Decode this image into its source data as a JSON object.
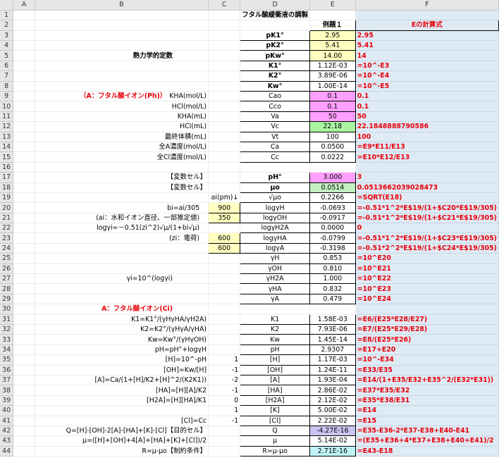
{
  "columns": [
    "A",
    "B",
    "C",
    "D",
    "E",
    "F"
  ],
  "title": "フタル酸緩衝液の調製",
  "row2": {
    "E": "例題１",
    "F": "Eの計算式"
  },
  "thermo_label": "熱力学的定数",
  "section_A_Ph": "（A：フタル酸イオン(Ph)）",
  "section_A_Ci": "A：フタル酸イオン(Ci)",
  "rows": [
    {
      "n": "1",
      "B": "",
      "C": "",
      "D": "",
      "E": "",
      "F": ""
    },
    {
      "n": "2",
      "B": "",
      "C": "",
      "D": "",
      "E": "例題１",
      "F": "Eの計算式"
    },
    {
      "n": "3",
      "B": "",
      "C": "",
      "D": "pK1°",
      "E": "2.95",
      "F": "2.95"
    },
    {
      "n": "4",
      "B": "",
      "C": "",
      "D": "pK2°",
      "E": "5.41",
      "F": "5.41"
    },
    {
      "n": "5",
      "B": "熱力学的定数",
      "C": "",
      "D": "pKw°",
      "E": "14.00",
      "F": "14"
    },
    {
      "n": "6",
      "B": "",
      "C": "",
      "D": "K1°",
      "E": "1.12E-03",
      "F": "=10^-E3"
    },
    {
      "n": "7",
      "B": "",
      "C": "",
      "D": "K2°",
      "E": "3.89E-06",
      "F": "=10^-E4"
    },
    {
      "n": "8",
      "B": "",
      "C": "",
      "D": "Kw°",
      "E": "1.00E-14",
      "F": "=10^-E5"
    },
    {
      "n": "9",
      "B": "KHA(mol/L)",
      "C": "",
      "D": "Cao",
      "E": "0.1",
      "F": "0.1"
    },
    {
      "n": "10",
      "B": "HCl(mol/L)",
      "C": "",
      "D": "Cco",
      "E": "0.1",
      "F": "0.1"
    },
    {
      "n": "11",
      "B": "KHA(mL)",
      "C": "",
      "D": "Va",
      "E": "50",
      "F": "50"
    },
    {
      "n": "12",
      "B": "HCl(mL)",
      "C": "",
      "D": "Vc",
      "E": "22.18",
      "F": "22.1848888790586"
    },
    {
      "n": "13",
      "B": "最終体積(mL)",
      "C": "",
      "D": "Vt",
      "E": "100",
      "F": "100"
    },
    {
      "n": "14",
      "B": "全A濃度(mol/L)",
      "C": "",
      "D": "Ca",
      "E": "0.0500",
      "F": "=E9*E11/E13"
    },
    {
      "n": "15",
      "B": "全Cl濃度(mol/L)",
      "C": "",
      "D": "Cc",
      "E": "0.0222",
      "F": "=E10*E12/E13"
    },
    {
      "n": "16",
      "B": "",
      "C": "",
      "D": "",
      "E": "",
      "F": ""
    },
    {
      "n": "17",
      "B": "【変数セル】",
      "C": "",
      "D": "pH°",
      "E": "3.000",
      "F": "3"
    },
    {
      "n": "18",
      "B": "【変数セル】",
      "C": "",
      "D": "μo",
      "E": "0.0514",
      "F": "0.0513662039028473"
    },
    {
      "n": "19",
      "B": "",
      "C": "ai(pm)↓",
      "D": "√μo",
      "E": "0.2266",
      "F": "=SQRT(E18)"
    },
    {
      "n": "20",
      "B": "bi=ai/305",
      "C": "900",
      "D": "logγH",
      "E": "-0.0693",
      "F": "=-0.51*1^2*E$19/(1+$C20*E$19/305)"
    },
    {
      "n": "21",
      "B": "(ai：水和イオン直径、一部推定値)",
      "C": "350",
      "D": "logγOH",
      "E": "-0.0917",
      "F": "=-0.51*1^2*E$19/(1+$C21*E$19/305)"
    },
    {
      "n": "22",
      "B": "logγi=－0.51(zi^2)√μ/(1+bi√μ)",
      "C": "",
      "D": "logγH2A",
      "E": "0.0000",
      "F": "0"
    },
    {
      "n": "23",
      "B": "(zi：電荷)",
      "C": "600",
      "D": "logγHA",
      "E": "-0.0799",
      "F": "=-0.51*1^2*E$19/(1+$C23*E$19/305)"
    },
    {
      "n": "24",
      "B": "",
      "C": "600",
      "D": "logγA",
      "E": "-0.3198",
      "F": "=-0.51*2^2*E$19/(1+$C24*E$19/305)"
    },
    {
      "n": "25",
      "B": "",
      "C": "",
      "D": "γH",
      "E": "0.853",
      "F": "=10^E20"
    },
    {
      "n": "26",
      "B": "",
      "C": "",
      "D": "γOH",
      "E": "0.810",
      "F": "=10^E21"
    },
    {
      "n": "27",
      "B": "γi=10^(logγi)",
      "C": "",
      "D": "γH2A",
      "E": "1.000",
      "F": "=10^E22"
    },
    {
      "n": "28",
      "B": "",
      "C": "",
      "D": "γHA",
      "E": "0.832",
      "F": "=10^E23"
    },
    {
      "n": "29",
      "B": "",
      "C": "",
      "D": "γA",
      "E": "0.479",
      "F": "=10^E24"
    },
    {
      "n": "30",
      "B": "A：フタル酸イオン(Ci)",
      "C": "",
      "D": "",
      "E": "",
      "F": ""
    },
    {
      "n": "31",
      "B": "K1=K1°/(γHγHA/γH2A)",
      "C": "",
      "D": "K1",
      "E": "1.58E-03",
      "F": "=E6/(E25*E28/E27)"
    },
    {
      "n": "32",
      "B": "K2=K2°/(γHγA/γHA)",
      "C": "",
      "D": "K2",
      "E": "7.93E-06",
      "F": "=E7/(E25*E29/E28)"
    },
    {
      "n": "33",
      "B": "Kw=Kw°/(γHγOH)",
      "C": "",
      "D": "Kw",
      "E": "1.45E-14",
      "F": "=E8/(E25*E26)"
    },
    {
      "n": "34",
      "B": "pH=pH°+logγH",
      "C": "",
      "D": "pH",
      "E": "2.9307",
      "F": "=E17+E20"
    },
    {
      "n": "35",
      "B": "[H]=10^-pH",
      "C": "1",
      "D": "[H]",
      "E": "1.17E-03",
      "F": "=10^-E34"
    },
    {
      "n": "36",
      "B": "[OH]=Kw/[H]",
      "C": "-1",
      "D": "[OH]",
      "E": "1.24E-11",
      "F": "=E33/E35"
    },
    {
      "n": "37",
      "B": "[A]=Ca/(1+[H]/K2+[H]^2/(K2K1))",
      "C": "-2",
      "D": "[A]",
      "E": "1.93E-04",
      "F": "=E14/(1+E35/E32+E35^2/(E32*E31))"
    },
    {
      "n": "38",
      "B": "[HA]=[H][A]/K2",
      "C": "-1",
      "D": "[HA]",
      "E": "2.86E-02",
      "F": "=E37*E35/E32"
    },
    {
      "n": "39",
      "B": "[H2A]=[H][HA]/K1",
      "C": "0",
      "D": "[H2A]",
      "E": "2.12E-02",
      "F": "=E35*E38/E31"
    },
    {
      "n": "40",
      "B": "",
      "C": "1",
      "D": "[K]",
      "E": "5.00E-02",
      "F": "=E14"
    },
    {
      "n": "41",
      "B": "[Cl]=Cc",
      "C": "-1",
      "D": "[Cl]",
      "E": "2.22E-02",
      "F": "=E15"
    },
    {
      "n": "42",
      "B": "Q=[H]-[OH]-2[A]-[HA]+[K]-[Cl]【目的セル】",
      "C": "",
      "D": "Q",
      "E": "-4.27E-16",
      "F": "=E35-E36-2*E37-E38+E40-E41"
    },
    {
      "n": "43",
      "B": "μ=([H]+[OH]+4[A]+[HA]+[K]+[Cl])/2",
      "C": "",
      "D": "μ",
      "E": "5.14E-02",
      "F": "=(E35+E36+4*E37+E38+E40+E41)/2"
    },
    {
      "n": "44",
      "B": "R=μ-μo【制約条件】",
      "C": "",
      "D": "R=μ-μo",
      "E": "2.71E-16",
      "F": "=E43-E18"
    }
  ],
  "colors": {
    "yellow": "#ffffc0",
    "pink": "#ff9fff",
    "green": "#a9f5a0",
    "formula_bg": "#deeaf4",
    "formula_text": "#e8000a",
    "lavender": "#c9c5f2",
    "cyan": "#bff3f5"
  }
}
